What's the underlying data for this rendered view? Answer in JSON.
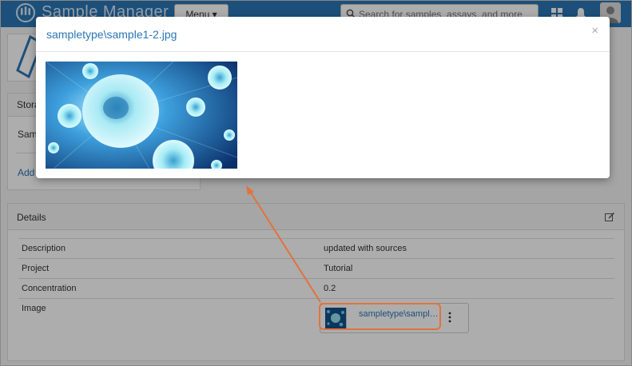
{
  "app": {
    "title": "Sample Manager",
    "menu_label": "Menu ▾",
    "search_placeholder": "Search for samples, assays, and more"
  },
  "storage": {
    "header": "Stora",
    "row_label": "Sam",
    "add_label": "Add"
  },
  "details": {
    "header": "Details",
    "rows": [
      {
        "key": "Description",
        "value": "updated with sources"
      },
      {
        "key": "Project",
        "value": "Tutorial"
      },
      {
        "key": "Concentration",
        "value": "0.2"
      },
      {
        "key": "Image",
        "value": ""
      }
    ],
    "image_file_name": "sampletype\\sample1-2.jpg"
  },
  "modal": {
    "title": "sampletype\\sample1-2.jpg",
    "close_glyph": "×"
  },
  "colors": {
    "brand": "#2a76b6",
    "annotation": "#e0733e"
  }
}
